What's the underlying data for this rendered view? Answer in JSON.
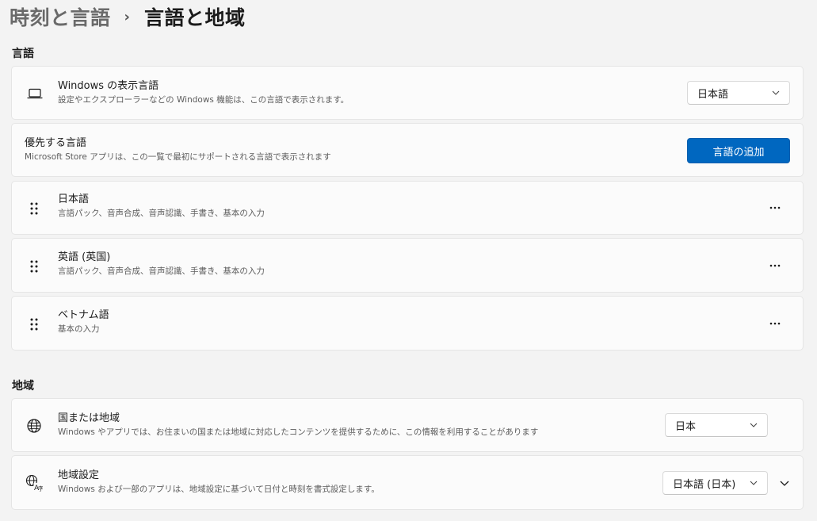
{
  "breadcrumb": {
    "parent": "時刻と言語",
    "separator": "›",
    "current": "言語と地域"
  },
  "language_section": {
    "title": "言語",
    "display_language": {
      "icon": "laptop-icon",
      "title": "Windows の表示言語",
      "subtitle": "設定やエクスプローラーなどの Windows 機能は、この言語で表示されます。",
      "selected": "日本語"
    },
    "preferred": {
      "title": "優先する言語",
      "subtitle": "Microsoft Store アプリは、この一覧で最初にサポートされる言語で表示されます",
      "add_button": "言語の追加"
    },
    "languages": [
      {
        "name": "日本語",
        "features": "言語パック、音声合成、音声認識、手書き、基本の入力"
      },
      {
        "name": "英語 (英国)",
        "features": "言語パック、音声合成、音声認識、手書き、基本の入力"
      },
      {
        "name": "ベトナム語",
        "features": "基本の入力"
      }
    ]
  },
  "region_section": {
    "title": "地域",
    "country": {
      "icon": "globe-icon",
      "title": "国または地域",
      "subtitle": "Windows やアプリでは、お住まいの国または地域に対応したコンテンツを提供するために、この情報を利用することがあります",
      "selected": "日本"
    },
    "regional_format": {
      "icon": "regional-format-icon",
      "title": "地域設定",
      "subtitle": "Windows および一部のアプリは、地域設定に基づいて日付と時刻を書式設定します。",
      "selected": "日本語 (日本)"
    }
  },
  "colors": {
    "accent": "#0067c0",
    "background": "#f3f3f3",
    "card": "#fbfbfb"
  }
}
